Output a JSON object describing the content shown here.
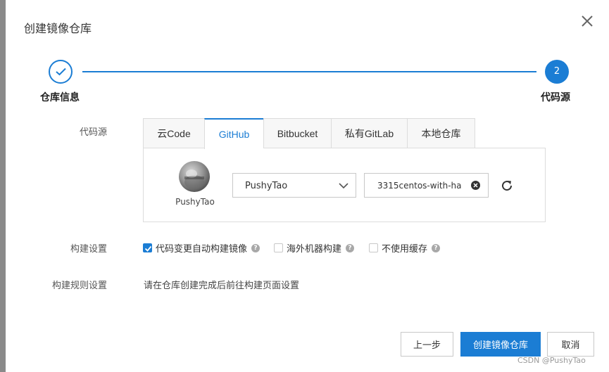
{
  "dialog": {
    "title": "创建镜像仓库"
  },
  "stepper": {
    "steps": [
      {
        "label": "仓库信息",
        "state": "done"
      },
      {
        "number": "2",
        "label": "代码源",
        "state": "active"
      }
    ],
    "accent": "#1b7dd4"
  },
  "form": {
    "source_label": "代码源",
    "tabs": [
      "云Code",
      "GitHub",
      "Bitbucket",
      "私有GitLab",
      "本地仓库"
    ],
    "active_tab": "GitHub",
    "account": {
      "name": "PushyTao"
    },
    "namespace_select": {
      "value": "PushyTao"
    },
    "repo_input": {
      "value": "3315centos-with-ha"
    },
    "build_label": "构建设置",
    "build_options": [
      {
        "label": "代码变更自动构建镜像",
        "checked": true
      },
      {
        "label": "海外机器构建",
        "checked": false
      },
      {
        "label": "不使用缓存",
        "checked": false
      }
    ],
    "rules_label": "构建规则设置",
    "rules_text": "请在仓库创建完成后前往构建页面设置"
  },
  "footer": {
    "prev_label": "上一步",
    "create_label": "创建镜像仓库",
    "cancel_label": "取消"
  },
  "watermark": "CSDN @PushyTao"
}
